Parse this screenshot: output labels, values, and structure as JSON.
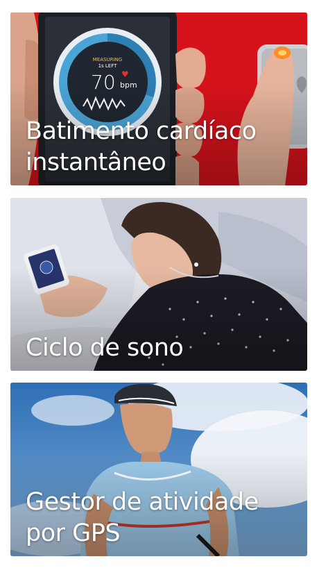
{
  "cards": [
    {
      "title_lines": [
        "Batimento cardíaco",
        "instantâneo"
      ],
      "illustration": "phone-heart-rate-screen",
      "accent_color": "#d9141c",
      "meter": {
        "status": "MEASURING",
        "timer": "1s LEFT",
        "bpm_value": "70",
        "bpm_unit": "bpm"
      }
    },
    {
      "title_lines": [
        "Ciclo de sono"
      ],
      "illustration": "woman-in-bed-with-phone",
      "accent_color": "#2a2630"
    },
    {
      "title_lines": [
        "Gestor de atividade",
        "por GPS"
      ],
      "illustration": "cyclist-under-sky",
      "accent_color": "#3e7fbf"
    }
  ]
}
